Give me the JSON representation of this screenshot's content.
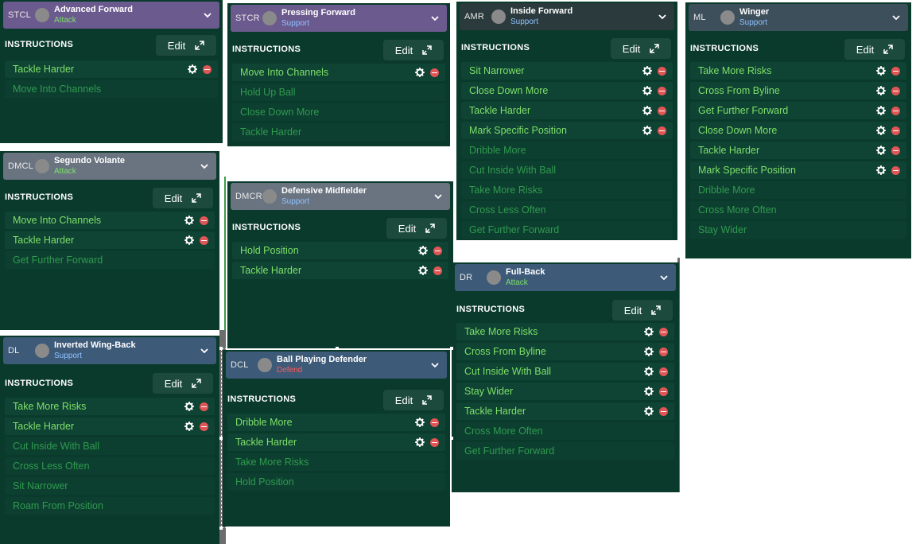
{
  "colors": {
    "panel_bg": "#0a3a2b",
    "attack_header": "#6b5a8e",
    "support_header": "#3b5a7a",
    "defend_header": "#3d5a78",
    "gray_header": "#5e6f7e",
    "active_text": "#7ee06a",
    "inactive_text": "#2f9a4e",
    "remove_red": "#e05656"
  },
  "common": {
    "instructions_label": "INSTRUCTIONS",
    "edit_label": "Edit"
  },
  "panels": [
    {
      "id": "stcl",
      "position": "STCL",
      "role": "Advanced Forward",
      "duty": "Attack",
      "duty_color": "#7ee06a",
      "header_color": "#6b5a8e",
      "instructions": [
        {
          "label": "Tackle Harder",
          "active": true
        },
        {
          "label": "Move Into Channels",
          "active": false
        }
      ]
    },
    {
      "id": "stcr",
      "position": "STCR",
      "role": "Pressing Forward",
      "duty": "Support",
      "duty_color": "#8fc3ff",
      "header_color": "#6b5a8e",
      "instructions": [
        {
          "label": "Move Into Channels",
          "active": true
        },
        {
          "label": "Hold Up Ball",
          "active": false
        },
        {
          "label": "Close Down More",
          "active": false
        },
        {
          "label": "Tackle Harder",
          "active": false
        }
      ]
    },
    {
      "id": "amr",
      "position": "AMR",
      "role": "Inside Forward",
      "duty": "Support",
      "duty_color": "#8fc3ff",
      "header_color": "#2b3a3c",
      "instructions": [
        {
          "label": "Sit Narrower",
          "active": true
        },
        {
          "label": "Close Down More",
          "active": true
        },
        {
          "label": "Tackle Harder",
          "active": true
        },
        {
          "label": "Mark Specific Position",
          "active": true
        },
        {
          "label": "Dribble More",
          "active": false
        },
        {
          "label": "Cut Inside With Ball",
          "active": false
        },
        {
          "label": "Take More Risks",
          "active": false
        },
        {
          "label": "Cross Less Often",
          "active": false
        },
        {
          "label": "Get Further Forward",
          "active": false
        }
      ]
    },
    {
      "id": "ml",
      "position": "ML",
      "role": "Winger",
      "duty": "Support",
      "duty_color": "#8fc3ff",
      "header_color": "#3e4f5c",
      "instructions": [
        {
          "label": "Take More Risks",
          "active": true
        },
        {
          "label": "Cross From Byline",
          "active": true
        },
        {
          "label": "Get Further Forward",
          "active": true
        },
        {
          "label": "Close Down More",
          "active": true
        },
        {
          "label": "Tackle Harder",
          "active": true
        },
        {
          "label": "Mark Specific Position",
          "active": true
        },
        {
          "label": "Dribble More",
          "active": false
        },
        {
          "label": "Cross More Often",
          "active": false
        },
        {
          "label": "Stay Wider",
          "active": false
        }
      ]
    },
    {
      "id": "dmcl",
      "position": "DMCL",
      "role": "Segundo Volante",
      "duty": "Attack",
      "duty_color": "#7ee06a",
      "header_color": "#6a7480",
      "instructions": [
        {
          "label": "Move Into Channels",
          "active": true
        },
        {
          "label": "Tackle Harder",
          "active": true
        },
        {
          "label": "Get Further Forward",
          "active": false
        }
      ]
    },
    {
      "id": "dmcr",
      "position": "DMCR",
      "role": "Defensive Midfielder",
      "duty": "Support",
      "duty_color": "#8fc3ff",
      "header_color": "#6a7480",
      "instructions": [
        {
          "label": "Hold Position",
          "active": true
        },
        {
          "label": "Tackle Harder",
          "active": true
        }
      ]
    },
    {
      "id": "dr",
      "position": "DR",
      "role": "Full-Back",
      "duty": "Attack",
      "duty_color": "#7ee06a",
      "header_color": "#3d5a78",
      "instructions": [
        {
          "label": "Take More Risks",
          "active": true
        },
        {
          "label": "Cross From Byline",
          "active": true
        },
        {
          "label": "Cut Inside With Ball",
          "active": true
        },
        {
          "label": "Stay Wider",
          "active": true
        },
        {
          "label": "Tackle Harder",
          "active": true
        },
        {
          "label": "Cross More Often",
          "active": false
        },
        {
          "label": "Get Further Forward",
          "active": false
        }
      ]
    },
    {
      "id": "dl",
      "position": "DL",
      "role": "Inverted Wing-Back",
      "duty": "Support",
      "duty_color": "#8fc3ff",
      "header_color": "#3d5a78",
      "instructions": [
        {
          "label": "Take More Risks",
          "active": true
        },
        {
          "label": "Tackle Harder",
          "active": true
        },
        {
          "label": "Cut Inside With Ball",
          "active": false
        },
        {
          "label": "Cross Less Often",
          "active": false
        },
        {
          "label": "Sit Narrower",
          "active": false
        },
        {
          "label": "Roam From Position",
          "active": false
        }
      ]
    },
    {
      "id": "dcl",
      "position": "DCL",
      "role": "Ball Playing Defender",
      "duty": "Defend",
      "duty_color": "#ff5a5a",
      "header_color": "#3d5a78",
      "instructions": [
        {
          "label": "Dribble More",
          "active": true
        },
        {
          "label": "Tackle Harder",
          "active": true
        },
        {
          "label": "Take More Risks",
          "active": false
        },
        {
          "label": "Hold Position",
          "active": false
        }
      ]
    }
  ]
}
